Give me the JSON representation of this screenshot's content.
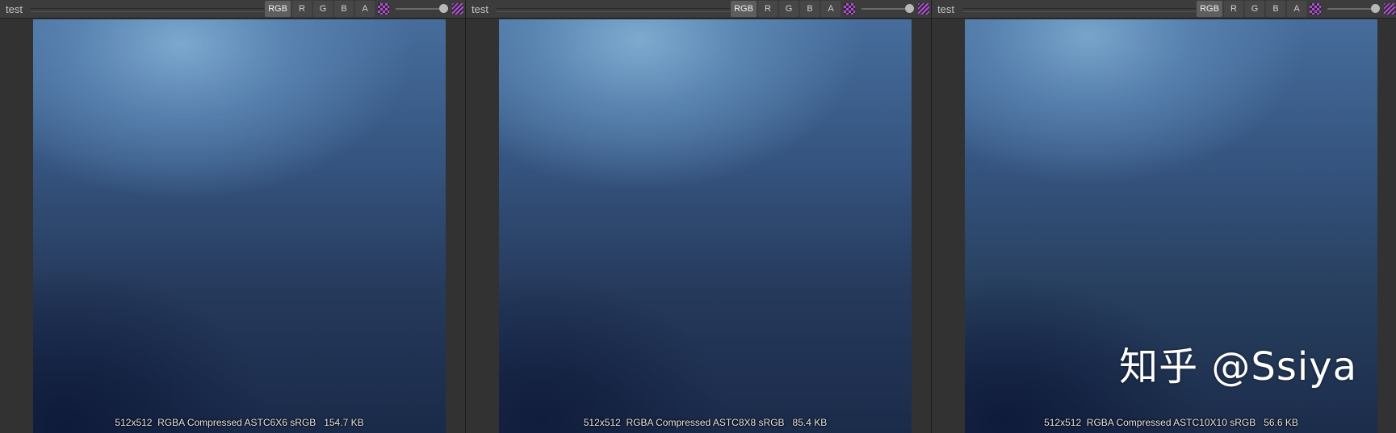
{
  "panels": [
    {
      "title": "test",
      "channels": [
        "RGB",
        "R",
        "G",
        "B",
        "A"
      ],
      "info": "512x512  RGBA Compressed ASTC6X6 sRGB   154.7 KB"
    },
    {
      "title": "test",
      "channels": [
        "RGB",
        "R",
        "G",
        "B",
        "A"
      ],
      "info": "512x512  RGBA Compressed ASTC8X8 sRGB   85.4 KB"
    },
    {
      "title": "test",
      "channels": [
        "RGB",
        "R",
        "G",
        "B",
        "A"
      ],
      "info": "512x512  RGBA Compressed ASTC10X10 sRGB   56.6 KB"
    }
  ],
  "icons": {
    "checker": "checkerboard-background-icon",
    "stripe": "transparency-stripe-icon"
  },
  "colors": {
    "accent": "#b24bd8"
  },
  "watermark": "知乎 @Ssiya"
}
